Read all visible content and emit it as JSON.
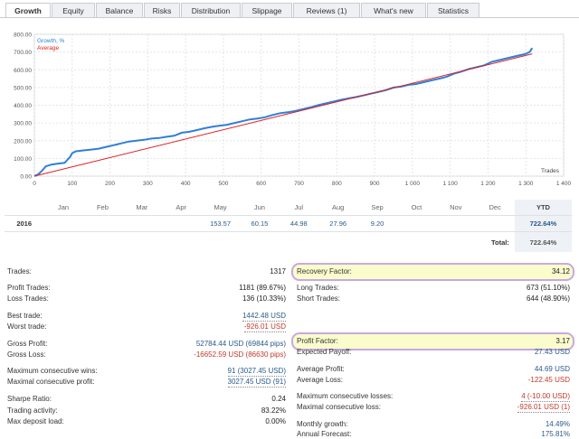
{
  "tabs": [
    {
      "label": "Growth",
      "active": true
    },
    {
      "label": "Equity",
      "active": false
    },
    {
      "label": "Balance",
      "active": false
    },
    {
      "label": "Risks",
      "active": false
    },
    {
      "label": "Distribution",
      "active": false
    },
    {
      "label": "Slippage",
      "active": false
    },
    {
      "label": "Reviews (1)",
      "active": false
    },
    {
      "label": "What's new",
      "active": false
    },
    {
      "label": "Statistics",
      "active": false
    }
  ],
  "colors": {
    "growth": "#2f7fd8",
    "average": "#e02020",
    "accent_border": "#c6a9e3",
    "highlight_bg": "#fafccc"
  },
  "chart_data": {
    "type": "line",
    "xlabel": "Trades",
    "ylabel": "",
    "xlim": [
      0,
      1400
    ],
    "ylim": [
      0,
      800
    ],
    "x_ticks": [
      "0",
      "100",
      "200",
      "300",
      "400",
      "500",
      "600",
      "700",
      "800",
      "900",
      "1 000",
      "1 100",
      "1 200",
      "1 300",
      "1 400"
    ],
    "y_ticks": [
      "0.00",
      "100.00",
      "200.00",
      "300.00",
      "400.00",
      "500.00",
      "600.00",
      "700.00",
      "800.00"
    ],
    "legend": [
      "Growth, %",
      "Average"
    ],
    "legend_position": "top-left",
    "grid": true,
    "series": [
      {
        "name": "Growth, %",
        "x": [
          0,
          10,
          20,
          30,
          45,
          60,
          80,
          95,
          100,
          110,
          130,
          150,
          170,
          190,
          210,
          230,
          250,
          270,
          290,
          310,
          330,
          350,
          370,
          390,
          410,
          430,
          450,
          470,
          490,
          510,
          530,
          550,
          570,
          590,
          610,
          630,
          650,
          670,
          690,
          710,
          730,
          750,
          770,
          790,
          810,
          830,
          850,
          870,
          890,
          910,
          930,
          950,
          970,
          990,
          1010,
          1030,
          1050,
          1070,
          1090,
          1110,
          1130,
          1150,
          1170,
          1190,
          1210,
          1230,
          1250,
          1270,
          1290,
          1300,
          1310,
          1317
        ],
        "y": [
          0,
          10,
          30,
          55,
          65,
          70,
          75,
          110,
          130,
          140,
          145,
          150,
          155,
          165,
          175,
          185,
          195,
          200,
          205,
          212,
          215,
          222,
          228,
          245,
          250,
          260,
          270,
          278,
          285,
          290,
          300,
          310,
          320,
          325,
          332,
          345,
          355,
          360,
          368,
          378,
          388,
          400,
          410,
          420,
          430,
          438,
          446,
          455,
          465,
          475,
          485,
          500,
          505,
          515,
          520,
          530,
          540,
          550,
          560,
          578,
          590,
          605,
          615,
          625,
          645,
          655,
          665,
          675,
          685,
          690,
          700,
          722.64
        ]
      },
      {
        "name": "Average",
        "x": [
          0,
          1317
        ],
        "y": [
          0,
          690
        ]
      }
    ]
  },
  "monthly": {
    "year_header": "",
    "months": [
      "Jan",
      "Feb",
      "Mar",
      "Apr",
      "May",
      "Jun",
      "Jul",
      "Aug",
      "Sep",
      "Oct",
      "Nov",
      "Dec"
    ],
    "ytd_header": "YTD",
    "rows": [
      {
        "year": "2016",
        "values": [
          "",
          "",
          "",
          "",
          "153.57",
          "60.15",
          "44.98",
          "27.96",
          "9.20",
          "",
          "",
          ""
        ],
        "ytd": "722.64%"
      }
    ],
    "total_label": "Total:",
    "total_value": "722.64%"
  },
  "stats_left": [
    {
      "label": "Trades:",
      "value": "1317",
      "dotted": false,
      "color": "dark"
    },
    {
      "label": "Profit Trades:",
      "value": "1181 (89.67%)",
      "dotted": false,
      "color": "dark"
    },
    {
      "label": "Loss Trades:",
      "value": "136 (10.33%)",
      "dotted": false,
      "color": "dark"
    },
    {
      "label": "Best trade:",
      "value": "1442.48 USD",
      "dotted": true,
      "color": "blue"
    },
    {
      "label": "Worst trade:",
      "value": "-926.01 USD",
      "dotted": true,
      "color": "red"
    },
    {
      "label": "Gross Profit:",
      "value": "52784.44 USD (69844 pips)",
      "dotted": false,
      "color": "blue"
    },
    {
      "label": "Gross Loss:",
      "value": "-16652.59 USD (86630 pips)",
      "dotted": false,
      "color": "red"
    },
    {
      "label": "Maximum consecutive wins:",
      "value": "91 (3027.45 USD)",
      "dotted": true,
      "color": "blue"
    },
    {
      "label": "Maximal consecutive profit:",
      "value": "3027.45 USD (91)",
      "dotted": true,
      "color": "blue"
    },
    {
      "label": "Sharpe Ratio:",
      "value": "0.24",
      "dotted": false,
      "color": "dark"
    },
    {
      "label": "Trading activity:",
      "value": "83.22%",
      "dotted": false,
      "color": "dark"
    },
    {
      "label": "Max deposit load:",
      "value": "0.00%",
      "dotted": false,
      "color": "dark"
    }
  ],
  "stats_right": [
    {
      "label": "Recovery Factor:",
      "value": "34.12",
      "dotted": false,
      "color": "dark",
      "highlight": true
    },
    {
      "label": "Long Trades:",
      "value": "673 (51.10%)",
      "dotted": false,
      "color": "dark"
    },
    {
      "label": "Short Trades:",
      "value": "644 (48.90%)",
      "dotted": false,
      "color": "dark"
    },
    {
      "label": "Profit Factor:",
      "value": "3.17",
      "dotted": false,
      "color": "dark",
      "highlight": true
    },
    {
      "label": "Expected Payoff:",
      "value": "27.43 USD",
      "dotted": false,
      "color": "blue"
    },
    {
      "label": "Average Profit:",
      "value": "44.69 USD",
      "dotted": false,
      "color": "blue"
    },
    {
      "label": "Average Loss:",
      "value": "-122.45 USD",
      "dotted": false,
      "color": "red"
    },
    {
      "label": "Maximum consecutive losses:",
      "value": "4 (-10.00 USD)",
      "dotted": true,
      "color": "red"
    },
    {
      "label": "Maximal consecutive loss:",
      "value": "-926.01 USD (1)",
      "dotted": true,
      "color": "red"
    },
    {
      "label": "Monthly growth:",
      "value": "14.49%",
      "dotted": false,
      "color": "blue"
    },
    {
      "label": "Annual Forecast:",
      "value": "175.81%",
      "dotted": false,
      "color": "blue"
    }
  ]
}
